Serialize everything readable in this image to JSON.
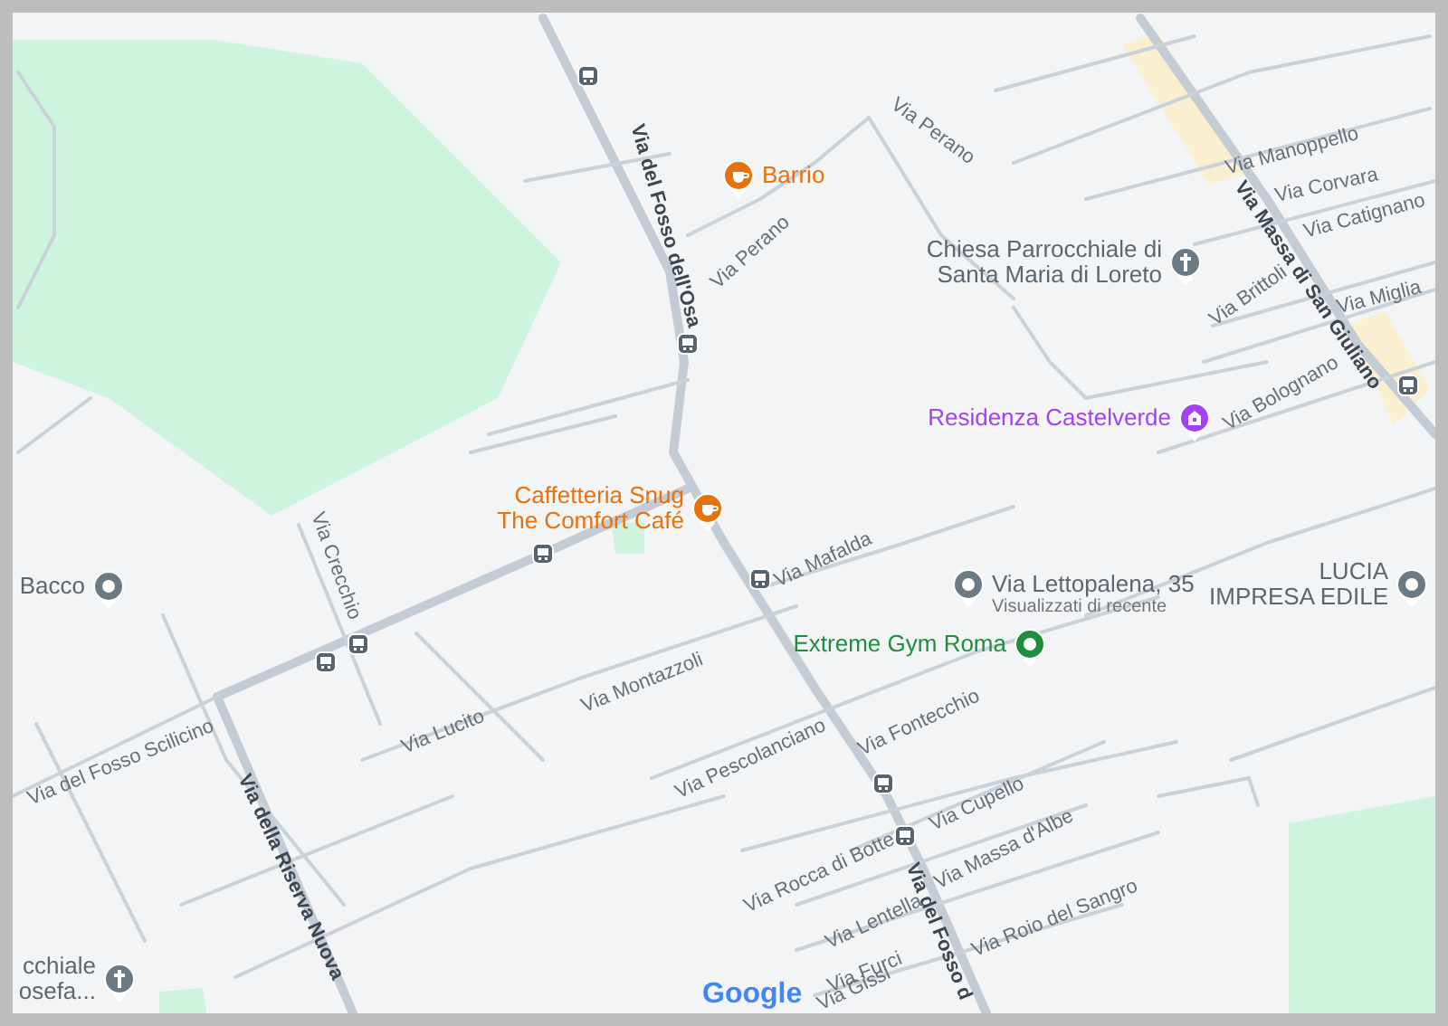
{
  "places": [
    {
      "kind": "cafe",
      "lines": [
        "Barrio"
      ],
      "color": "#e8710a"
    },
    {
      "kind": "cafe",
      "lines": [
        "Caffetteria Snug",
        "The Comfort Café"
      ],
      "color": "#e8710a"
    },
    {
      "kind": "church",
      "lines": [
        "Chiesa Parrocchiale di",
        "Santa Maria di Loreto"
      ],
      "color": "#6b7b86"
    },
    {
      "kind": "lodging",
      "lines": [
        "Residenza Castelverde"
      ],
      "color": "#a142f4"
    },
    {
      "kind": "place",
      "lines": [
        "Bacco"
      ],
      "color": "#6b7b86"
    },
    {
      "kind": "place",
      "lines": [
        "Via Lettopalena, 35"
      ],
      "subtitle": "Visualizzati di recente",
      "color": "#6b7b86"
    },
    {
      "kind": "place",
      "lines": [
        "LUCIA",
        "IMPRESA EDILE"
      ],
      "color": "#6b7b86"
    },
    {
      "kind": "gym",
      "lines": [
        "Extreme Gym Roma"
      ],
      "color": "#1e8e3e"
    },
    {
      "kind": "church",
      "lines": [
        "cchiale",
        "osefa..."
      ],
      "color": "#6b7b86"
    }
  ],
  "streets": [
    {
      "name": "Via del Fosso dell'Osa",
      "major": true
    },
    {
      "name": "Via Perano",
      "major": false
    },
    {
      "name": "Via Perano",
      "major": false
    },
    {
      "name": "Via Manoppello",
      "major": false
    },
    {
      "name": "Via Corvara",
      "major": false
    },
    {
      "name": "Via Catignano",
      "major": false
    },
    {
      "name": "Via Massa di San Giuliano",
      "major": true
    },
    {
      "name": "Via Brittoli",
      "major": false
    },
    {
      "name": "Via Miglia",
      "major": false
    },
    {
      "name": "Via Bolognano",
      "major": false
    },
    {
      "name": "Via Mafalda",
      "major": false
    },
    {
      "name": "Via Crecchio",
      "major": false
    },
    {
      "name": "Via Montazzoli",
      "major": false
    },
    {
      "name": "Via Lucito",
      "major": false
    },
    {
      "name": "Via del Fosso Scilicino",
      "major": false
    },
    {
      "name": "Via della Riserva Nuova",
      "major": true
    },
    {
      "name": "Via Pescolanciano",
      "major": false
    },
    {
      "name": "Via Fontecchio",
      "major": false
    },
    {
      "name": "Via Cupello",
      "major": false
    },
    {
      "name": "Via Massa d'Albe",
      "major": false
    },
    {
      "name": "Via Rocca di Botte",
      "major": false
    },
    {
      "name": "Via Lentella",
      "major": false
    },
    {
      "name": "Via Roio del Sangro",
      "major": false
    },
    {
      "name": "Via Furci",
      "major": false
    },
    {
      "name": "Via Gissi",
      "major": false
    },
    {
      "name": "Via del Fosso d",
      "major": true
    }
  ],
  "logo": "Google"
}
